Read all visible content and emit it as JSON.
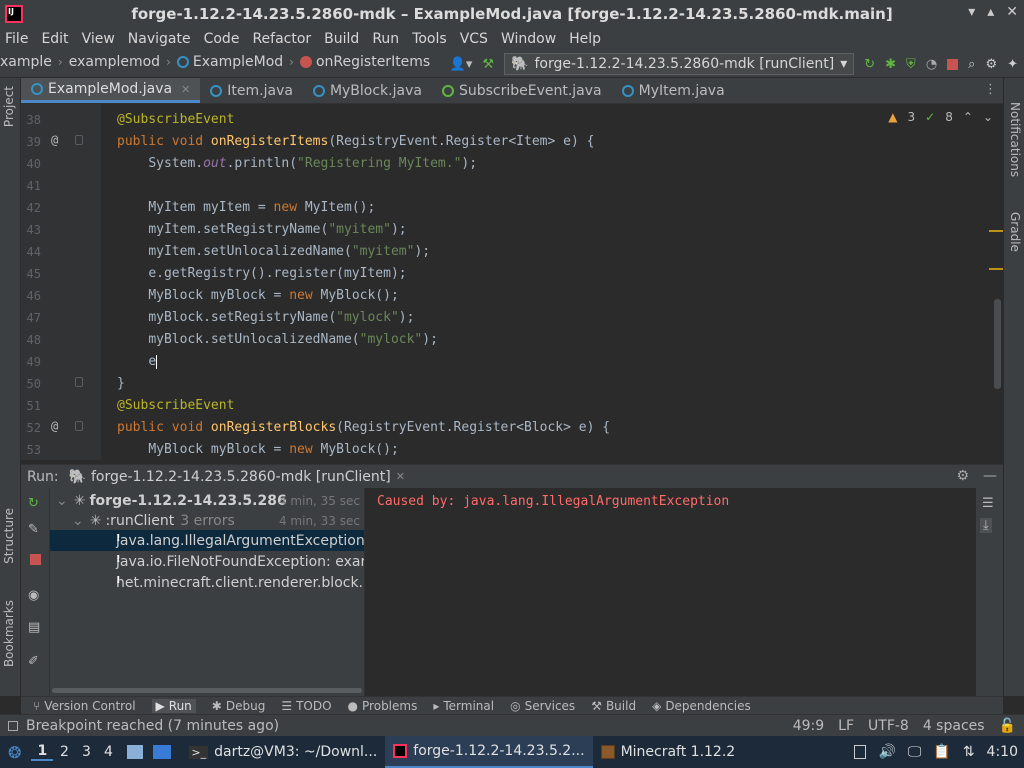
{
  "window": {
    "title": "forge-1.12.2-14.23.5.2860-mdk – ExampleMod.java [forge-1.12.2-14.23.5.2860-mdk.main]"
  },
  "menu": [
    "File",
    "Edit",
    "View",
    "Navigate",
    "Code",
    "Refactor",
    "Build",
    "Run",
    "Tools",
    "VCS",
    "Window",
    "Help"
  ],
  "breadcrumb": {
    "items": [
      "xample",
      "examplemod",
      "ExampleMod",
      "onRegisterItems"
    ]
  },
  "run_config": {
    "label": "forge-1.12.2-14.23.5.2860-mdk [runClient]"
  },
  "editor_tabs": [
    {
      "label": "ExampleMod.java",
      "active": true
    },
    {
      "label": "Item.java"
    },
    {
      "label": "MyBlock.java"
    },
    {
      "label": "SubscribeEvent.java"
    },
    {
      "label": "MyItem.java"
    }
  ],
  "inspections": {
    "warnings": "3",
    "weak_warnings": "8"
  },
  "code_lines": [
    {
      "num": "38"
    },
    {
      "num": "39"
    },
    {
      "num": "40"
    },
    {
      "num": "41"
    },
    {
      "num": "42"
    },
    {
      "num": "43"
    },
    {
      "num": "44"
    },
    {
      "num": "45"
    },
    {
      "num": "46"
    },
    {
      "num": "47"
    },
    {
      "num": "48"
    },
    {
      "num": "49"
    },
    {
      "num": "50"
    },
    {
      "num": "51"
    },
    {
      "num": "52"
    },
    {
      "num": "53"
    }
  ],
  "code": {
    "l38": "@SubscribeEvent",
    "l39_kw": "public void ",
    "l39_fn": "onRegisterItems",
    "l39_rest": "(RegistryEvent.Register<Item> e) {",
    "l40_a": "System.",
    "l40_out": "out",
    "l40_b": ".println(",
    "l40_str": "\"Registering MyItem.\"",
    "l40_c": ");",
    "l42_a": "MyItem myItem = ",
    "l42_new": "new ",
    "l42_b": "MyItem();",
    "l43_a": "myItem.setRegistryName(",
    "l43_str": "\"myitem\"",
    "l43_b": ");",
    "l44_a": "myItem.setUnlocalizedName(",
    "l44_str": "\"myitem\"",
    "l44_b": ");",
    "l45": "e.getRegistry().register(myItem);",
    "l46_a": "MyBlock myBlock = ",
    "l46_new": "new ",
    "l46_b": "MyBlock();",
    "l47_a": "myBlock.setRegistryName(",
    "l47_str": "\"mylock\"",
    "l47_b": ");",
    "l48_a": "myBlock.setUnlocalizedName(",
    "l48_str": "\"mylock\"",
    "l48_b": ");",
    "l49": "e",
    "l50": "}",
    "l51": "@SubscribeEvent",
    "l52_kw": "public void ",
    "l52_fn": "onRegisterBlocks",
    "l52_rest": "(RegistryEvent.Register<Block> e) {",
    "l53_a": "MyBlock myBlock = ",
    "l53_new": "new ",
    "l53_b": "MyBlock();"
  },
  "run_panel": {
    "label": "Run:",
    "tab": "forge-1.12.2-14.23.5.2860-mdk [runClient]",
    "tree": [
      {
        "label": "forge-1.12.2-14.23.5.286",
        "time": "4 min, 35 sec"
      },
      {
        "label": ":runClient",
        "extra": "3 errors",
        "time": "4 min, 33 sec"
      },
      {
        "label": "java.lang.IllegalArgumentException"
      },
      {
        "label": "java.io.FileNotFoundException: exar"
      },
      {
        "label": "net.minecraft.client.renderer.block.r"
      }
    ],
    "console_output": "Caused by: java.lang.IllegalArgumentException"
  },
  "side_labels": {
    "project": "Project",
    "structure": "Structure",
    "bookmarks": "Bookmarks",
    "notifications": "Notifications",
    "gradle": "Gradle"
  },
  "bottom_tabs": [
    "Version Control",
    "Run",
    "Debug",
    "TODO",
    "Problems",
    "Terminal",
    "Services",
    "Build",
    "Dependencies"
  ],
  "status": {
    "message": "Breakpoint reached (7 minutes ago)",
    "position": "49:9",
    "line_sep": "LF",
    "encoding": "UTF-8",
    "indent": "4 spaces"
  },
  "taskbar": {
    "workspaces": [
      "1",
      "2",
      "3",
      "4"
    ],
    "tasks": [
      {
        "label": "dartz@VM3: ~/Downl..."
      },
      {
        "label": "forge-1.12.2-14.23.5.2..."
      },
      {
        "label": "Minecraft 1.12.2"
      }
    ],
    "clock": "4:10"
  },
  "colors": {
    "bg": "#2b2b2b",
    "panel": "#3c3f41",
    "accent": "#4a88c7",
    "error": "#ff6b68",
    "keyword": "#cc7832",
    "string": "#6a8759",
    "function": "#ffc66d"
  }
}
